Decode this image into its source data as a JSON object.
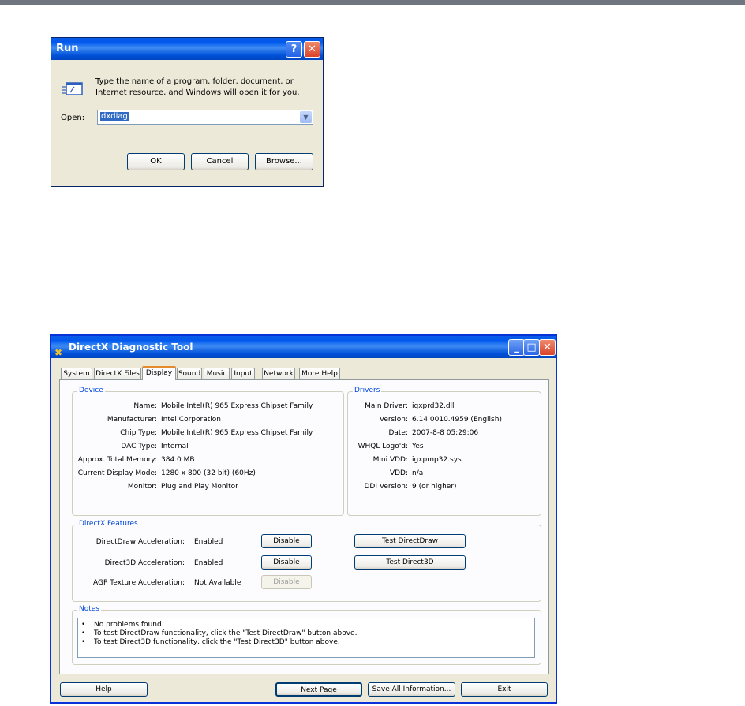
{
  "run": {
    "title": "Run",
    "help_glyph": "?",
    "close_glyph": "✕",
    "description_line1": "Type the name of a program, folder, document, or",
    "description_line2": "Internet resource, and Windows will open it for you.",
    "open_label": "Open:",
    "open_value": "dxdiag",
    "ok_label": "OK",
    "cancel_label": "Cancel",
    "browse_label": "Browse..."
  },
  "dx": {
    "title": "DirectX Diagnostic Tool",
    "min_glyph": "_",
    "max_glyph": "□",
    "close_glyph": "✕",
    "tabs": [
      {
        "label": "System"
      },
      {
        "label": "DirectX Files"
      },
      {
        "label": "Display"
      },
      {
        "label": "Sound"
      },
      {
        "label": "Music"
      },
      {
        "label": "Input"
      },
      {
        "label": "Network"
      },
      {
        "label": "More Help"
      }
    ],
    "active_tab": "Display",
    "device": {
      "title": "Device",
      "rows": [
        {
          "label": "Name:",
          "value": "Mobile Intel(R) 965 Express Chipset Family"
        },
        {
          "label": "Manufacturer:",
          "value": "Intel Corporation"
        },
        {
          "label": "Chip Type:",
          "value": "Mobile Intel(R) 965 Express Chipset Family"
        },
        {
          "label": "DAC Type:",
          "value": "Internal"
        },
        {
          "label": "Approx. Total Memory:",
          "value": "384.0 MB"
        },
        {
          "label": "Current Display Mode:",
          "value": "1280 x 800 (32 bit) (60Hz)"
        },
        {
          "label": "Monitor:",
          "value": "Plug and Play Monitor"
        }
      ]
    },
    "drivers": {
      "title": "Drivers",
      "rows": [
        {
          "label": "Main Driver:",
          "value": "igxprd32.dll"
        },
        {
          "label": "Version:",
          "value": "6.14.0010.4959 (English)"
        },
        {
          "label": "Date:",
          "value": "2007-8-8 05:29:06"
        },
        {
          "label": "WHQL Logo'd:",
          "value": "Yes"
        },
        {
          "label": "Mini VDD:",
          "value": "igxpmp32.sys"
        },
        {
          "label": "VDD:",
          "value": "n/a"
        },
        {
          "label": "DDI Version:",
          "value": "9 (or higher)"
        }
      ]
    },
    "features": {
      "title": "DirectX Features",
      "rows": [
        {
          "label": "DirectDraw Acceleration:",
          "status": "Enabled",
          "button": "Disable",
          "test": "Test DirectDraw"
        },
        {
          "label": "Direct3D Acceleration:",
          "status": "Enabled",
          "button": "Disable",
          "test": "Test Direct3D"
        },
        {
          "label": "AGP Texture Acceleration:",
          "status": "Not Available",
          "button": "Disable"
        }
      ]
    },
    "notes": {
      "title": "Notes",
      "lines": [
        "No problems found.",
        "To test DirectDraw functionality, click the \"Test DirectDraw\" button above.",
        "To test Direct3D functionality, click the \"Test Direct3D\" button above."
      ]
    },
    "buttons": {
      "help": "Help",
      "next_page": "Next Page",
      "save_all": "Save All Information...",
      "exit": "Exit"
    }
  }
}
